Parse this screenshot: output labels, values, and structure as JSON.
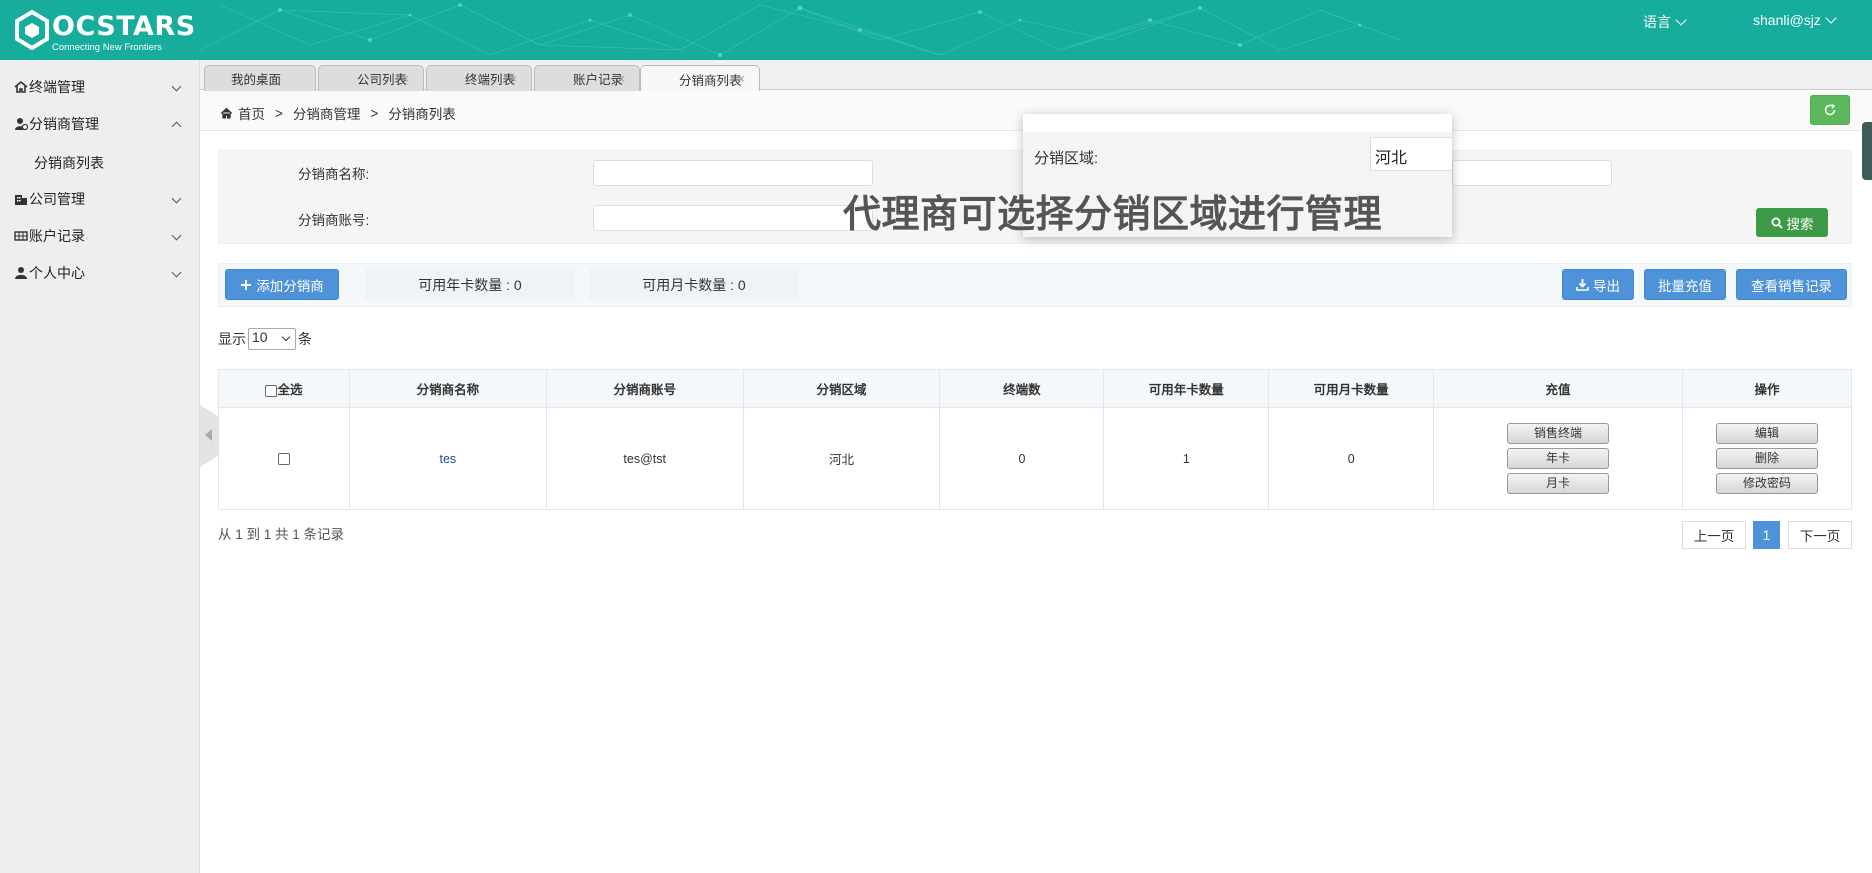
{
  "header": {
    "logo_text": "OCSTARS",
    "logo_tagline": "Connecting New Frontiers",
    "language_menu": "语言",
    "user_menu": "shanli@sjz",
    "bg_color": "#16ad9c"
  },
  "sidebar": {
    "items": [
      {
        "label": "终端管理",
        "icon": "home-icon",
        "expanded": false
      },
      {
        "label": "分销商管理",
        "icon": "user-group-icon",
        "expanded": true
      },
      {
        "label": "公司管理",
        "icon": "building-icon",
        "expanded": false
      },
      {
        "label": "账户记录",
        "icon": "table-icon",
        "expanded": false
      },
      {
        "label": "个人中心",
        "icon": "user-icon",
        "expanded": false
      }
    ],
    "sub_items": [
      {
        "label": "分销商列表"
      }
    ]
  },
  "tabs": [
    {
      "label": "我的桌面",
      "closable": false
    },
    {
      "label": "公司列表",
      "closable": true
    },
    {
      "label": "终端列表",
      "closable": true
    },
    {
      "label": "账户记录",
      "closable": true
    },
    {
      "label": "分销商列表",
      "closable": true,
      "active": true
    }
  ],
  "breadcrumb": {
    "home": "首页",
    "sep": ">",
    "level1": "分销商管理",
    "level2": "分销商列表"
  },
  "search": {
    "name_label": "分销商名称:",
    "account_label": "分销商账号:",
    "search_button": "搜索"
  },
  "popup": {
    "region_label": "分销区域:",
    "region_value": "河北"
  },
  "overlay_caption": "代理商可选择分销区域进行管理",
  "toolbar": {
    "add_button": "添加分销商",
    "yearly_cards": "可用年卡数量 : 0",
    "monthly_cards": "可用月卡数量 : 0",
    "export_button": "导出",
    "batch_recharge_button": "批量充值",
    "sales_records_button": "查看销售记录"
  },
  "pagesize": {
    "prefix": "显示",
    "value": "10",
    "suffix": "条"
  },
  "table": {
    "columns": [
      "全选",
      "分销商名称",
      "分销商账号",
      "分销区域",
      "终端数",
      "可用年卡数量",
      "可用月卡数量",
      "充值",
      "操作"
    ],
    "rows": [
      {
        "name": "tes",
        "account": "tes@tst",
        "region": "河北",
        "terminals": "0",
        "yearly": "1",
        "monthly": "0",
        "recharge_actions": [
          "销售终端",
          "年卡",
          "月卡"
        ],
        "ops": [
          "编辑",
          "删除",
          "修改密码"
        ]
      }
    ]
  },
  "footer": {
    "info": "从 1 到 1 共 1 条记录",
    "prev": "上一页",
    "page": "1",
    "next": "下一页"
  }
}
